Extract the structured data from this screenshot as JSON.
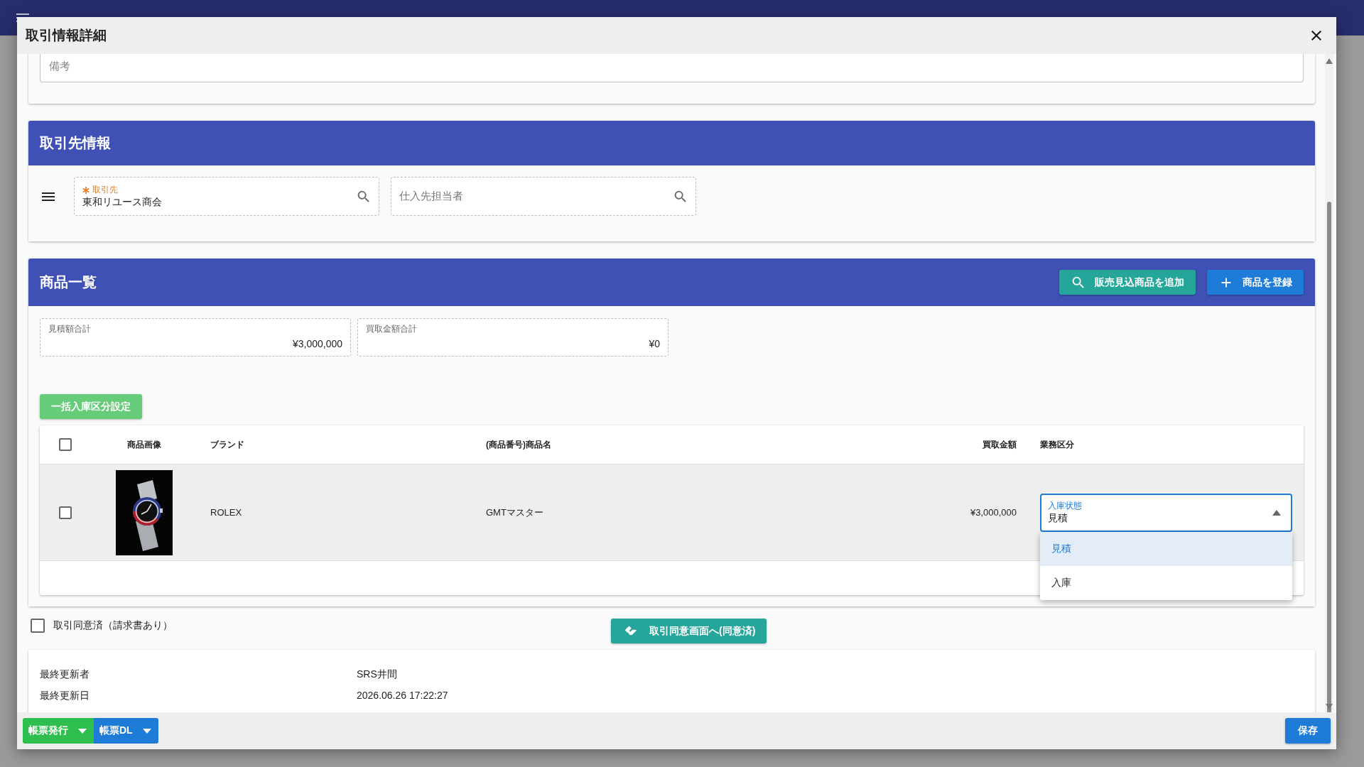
{
  "dialog": {
    "title": "取引情報詳細"
  },
  "remarks": {
    "placeholder": "備考"
  },
  "supplier_section": {
    "title": "取引先情報",
    "fields": [
      {
        "label": "取引先",
        "required": true,
        "value": "東和リユース商会"
      },
      {
        "placeholder": "仕入先担当者"
      }
    ]
  },
  "products_section": {
    "title": "商品一覧",
    "actions": [
      {
        "kind": "search",
        "label": "販売見込商品を追加"
      },
      {
        "kind": "add",
        "label": "商品を登録"
      }
    ],
    "totals": [
      {
        "label": "見積額合計",
        "value": "¥3,000,000"
      },
      {
        "label": "買取金額合計",
        "value": "¥0"
      }
    ],
    "bulk_button": "一括入庫区分設定",
    "table": {
      "header_checked": false,
      "columns": [
        "商品画像",
        "ブランド",
        "(商品番号)商品名",
        "買取金額",
        "業務区分"
      ],
      "rows": [
        {
          "checked": false,
          "brand": "ROLEX",
          "name": "GMTマスター",
          "price": "¥3,000,000",
          "status": {
            "label": "入庫状態",
            "value": "見積",
            "expanded": true,
            "options": [
              {
                "label": "見積",
                "selected": true
              },
              {
                "label": "入庫",
                "selected": false
              }
            ]
          }
        }
      ]
    }
  },
  "agreement": {
    "label": "取引同意済（請求書あり）",
    "checked": false
  },
  "agreement_button": "取引同意画面へ(同意済)",
  "info": [
    {
      "label": "最終更新者",
      "value": "SRS井間"
    },
    {
      "label": "最終更新日",
      "value": "2026.06.26 17:22:27"
    }
  ],
  "footer": {
    "menu_buttons": [
      {
        "label": "帳票発行",
        "color": "#2fbf4f"
      },
      {
        "label": "帳票DL",
        "color": "#1e7bd8"
      }
    ],
    "save_button": "保存"
  }
}
